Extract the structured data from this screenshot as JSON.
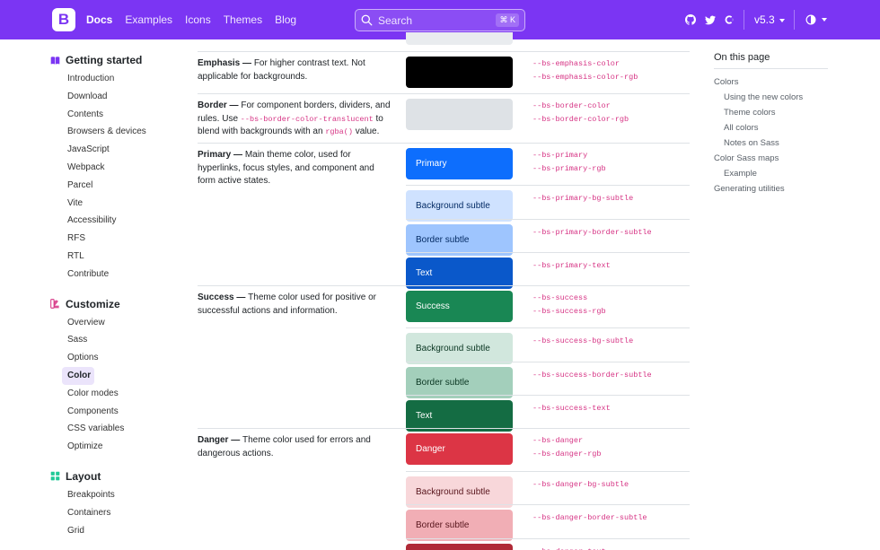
{
  "navbar": {
    "brand_letter": "B",
    "links": [
      "Docs",
      "Examples",
      "Icons",
      "Themes",
      "Blog"
    ],
    "search_placeholder": "Search",
    "search_shortcut": "⌘ K",
    "version": "v5.3",
    "accent": "#7b35f3"
  },
  "sidebar": {
    "sections": [
      {
        "title": "Getting started",
        "icon": "book-icon",
        "icon_color": "#7b35f3",
        "items": [
          "Introduction",
          "Download",
          "Contents",
          "Browsers & devices",
          "JavaScript",
          "Webpack",
          "Parcel",
          "Vite",
          "Accessibility",
          "RFS",
          "RTL",
          "Contribute"
        ]
      },
      {
        "title": "Customize",
        "icon": "palette-icon",
        "icon_color": "#d63384",
        "items": [
          "Overview",
          "Sass",
          "Options",
          "Color",
          "Color modes",
          "Components",
          "CSS variables",
          "Optimize"
        ],
        "active": "Color"
      },
      {
        "title": "Layout",
        "icon": "grid-icon",
        "icon_color": "#20c997",
        "items": [
          "Breakpoints",
          "Containers",
          "Grid"
        ]
      }
    ]
  },
  "table": {
    "rows": [
      {
        "id": "emphasis",
        "title": "Emphasis —",
        "text": "For higher contrast text. Not applicable for backgrounds.",
        "swatches": [
          {
            "label": "",
            "bg": "#000000",
            "fg": "#ffffff",
            "vars": [
              "--bs-emphasis-color",
              "--bs-emphasis-color-rgb"
            ]
          }
        ]
      },
      {
        "id": "border",
        "title": "Border —",
        "text_parts": [
          "For component borders, dividers, and rules. Use ",
          "--bs-border-color-translucent",
          " to blend with backgrounds with an ",
          "rgba()",
          " value."
        ],
        "swatches": [
          {
            "label": "",
            "bg": "#dee2e6",
            "fg": "#212529",
            "vars": [
              "--bs-border-color",
              "--bs-border-color-rgb"
            ]
          }
        ]
      },
      {
        "id": "primary",
        "title": "Primary —",
        "text": "Main theme color, used for hyperlinks, focus styles, and component and form active states.",
        "swatches": [
          {
            "label": "Primary",
            "bg": "#0d6efd",
            "fg": "#ffffff",
            "vars": [
              "--bs-primary",
              "--bs-primary-rgb"
            ]
          },
          {
            "label": "Background subtle",
            "bg": "#cfe2ff",
            "fg": "#052c65",
            "vars": [
              "--bs-primary-bg-subtle"
            ]
          },
          {
            "label": "Border subtle",
            "bg": "#9ec5fe",
            "fg": "#052c65",
            "vars": [
              "--bs-primary-border-subtle"
            ]
          },
          {
            "label": "Text",
            "bg": "#0a58ca",
            "fg": "#ffffff",
            "vars": [
              "--bs-primary-text"
            ]
          }
        ]
      },
      {
        "id": "success",
        "title": "Success —",
        "text": "Theme color used for positive or successful actions and information.",
        "swatches": [
          {
            "label": "Success",
            "bg": "#198754",
            "fg": "#ffffff",
            "vars": [
              "--bs-success",
              "--bs-success-rgb"
            ]
          },
          {
            "label": "Background subtle",
            "bg": "#d1e7dd",
            "fg": "#0a3622",
            "vars": [
              "--bs-success-bg-subtle"
            ]
          },
          {
            "label": "Border subtle",
            "bg": "#a3cfbb",
            "fg": "#0a3622",
            "vars": [
              "--bs-success-border-subtle"
            ]
          },
          {
            "label": "Text",
            "bg": "#146c43",
            "fg": "#ffffff",
            "vars": [
              "--bs-success-text"
            ]
          }
        ]
      },
      {
        "id": "danger",
        "title": "Danger —",
        "text": "Theme color used for errors and dangerous actions.",
        "swatches": [
          {
            "label": "Danger",
            "bg": "#dc3545",
            "fg": "#ffffff",
            "vars": [
              "--bs-danger",
              "--bs-danger-rgb"
            ]
          },
          {
            "label": "Background subtle",
            "bg": "#f8d7da",
            "fg": "#58151c",
            "vars": [
              "--bs-danger-bg-subtle"
            ]
          },
          {
            "label": "Border subtle",
            "bg": "#f1aeb5",
            "fg": "#58151c",
            "vars": [
              "--bs-danger-border-subtle"
            ]
          },
          {
            "label": "",
            "bg": "#b02a37",
            "fg": "#ffffff",
            "vars": [
              "--bs-danger-text"
            ]
          }
        ]
      }
    ]
  },
  "toc": {
    "title": "On this page",
    "items": [
      {
        "label": "Colors",
        "sub": false
      },
      {
        "label": "Using the new colors",
        "sub": true
      },
      {
        "label": "Theme colors",
        "sub": true
      },
      {
        "label": "All colors",
        "sub": true
      },
      {
        "label": "Notes on Sass",
        "sub": true
      },
      {
        "label": "Color Sass maps",
        "sub": false
      },
      {
        "label": "Example",
        "sub": true
      },
      {
        "label": "Generating utilities",
        "sub": false
      }
    ]
  }
}
